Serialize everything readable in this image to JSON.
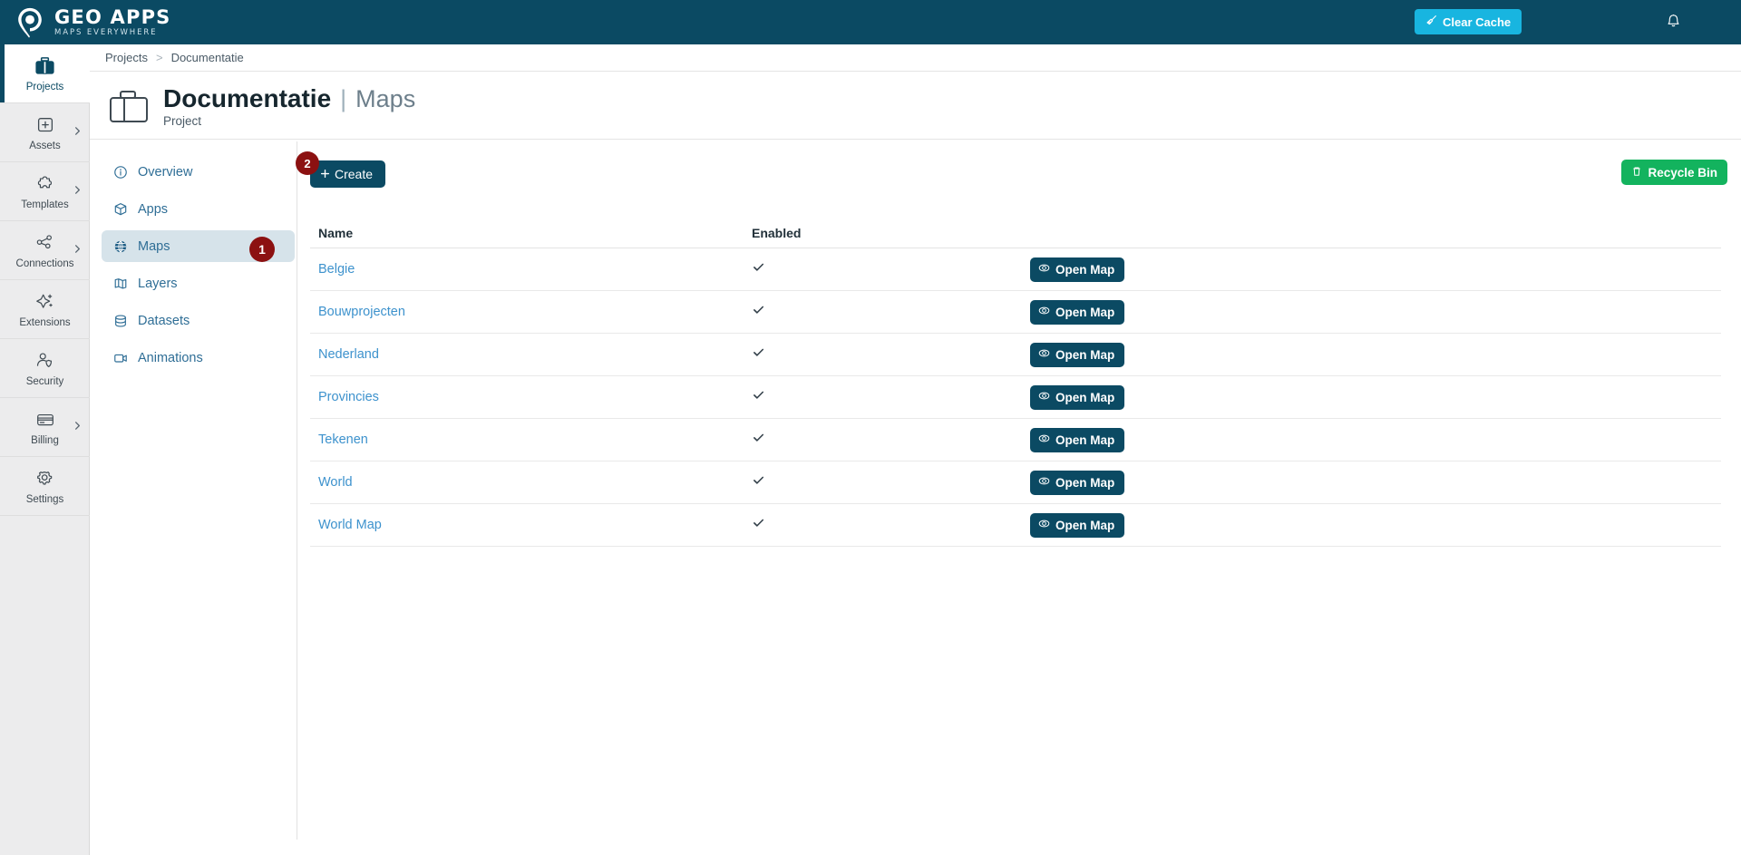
{
  "brand": {
    "name": "GEO APPS",
    "tagline": "MAPS EVERYWHERE",
    "logo_icon": "map-pin-logo-icon"
  },
  "topbar": {
    "clear_cache_label": "Clear Cache",
    "clear_cache_icon": "broom-icon",
    "clear_cache_color": "#18b5e0",
    "notifications_icon": "bell-icon",
    "background_color": "#0b4a63"
  },
  "rail": {
    "items": [
      {
        "label": "Projects",
        "icon": "briefcase-icon",
        "active": true,
        "expandable": false
      },
      {
        "label": "Assets",
        "icon": "plus-square-icon",
        "active": false,
        "expandable": true
      },
      {
        "label": "Templates",
        "icon": "puzzle-icon",
        "active": false,
        "expandable": true
      },
      {
        "label": "Connections",
        "icon": "share-nodes-icon",
        "active": false,
        "expandable": true
      },
      {
        "label": "Extensions",
        "icon": "sparkle-icon",
        "active": false,
        "expandable": false
      },
      {
        "label": "Security",
        "icon": "user-shield-icon",
        "active": false,
        "expandable": false
      },
      {
        "label": "Billing",
        "icon": "credit-card-icon",
        "active": false,
        "expandable": true
      },
      {
        "label": "Settings",
        "icon": "gear-icon",
        "active": false,
        "expandable": false
      }
    ]
  },
  "breadcrumb": {
    "root": "Projects",
    "separator": ">",
    "current": "Documentatie"
  },
  "page_header": {
    "icon": "briefcase-icon",
    "title": "Documentatie",
    "pipe": "|",
    "section": "Maps",
    "subtitle": "Project"
  },
  "project_menu": {
    "items": [
      {
        "label": "Overview",
        "icon": "info-circle-icon",
        "active": false
      },
      {
        "label": "Apps",
        "icon": "cube-icon",
        "active": false
      },
      {
        "label": "Maps",
        "icon": "globe-icon",
        "active": true
      },
      {
        "label": "Layers",
        "icon": "layers-map-icon",
        "active": false
      },
      {
        "label": "Datasets",
        "icon": "database-icon",
        "active": false
      },
      {
        "label": "Animations",
        "icon": "video-icon",
        "active": false
      }
    ]
  },
  "badges": [
    {
      "number": "1",
      "target": "maps-menu-item",
      "color": "#8c1111"
    },
    {
      "number": "2",
      "target": "create-button",
      "color": "#8c1111"
    }
  ],
  "toolbar": {
    "create_label": "Create",
    "create_icon": "plus-icon",
    "create_color": "#0b4a63",
    "recycle_label": "Recycle Bin",
    "recycle_icon": "trash-icon",
    "recycle_color": "#13b35e"
  },
  "table": {
    "columns": [
      "Name",
      "Enabled",
      ""
    ],
    "action_label": "Open Map",
    "action_icon": "eye-icon",
    "check_glyph": "✓",
    "rows": [
      {
        "name": "Belgie",
        "enabled": true
      },
      {
        "name": "Bouwprojecten",
        "enabled": true
      },
      {
        "name": "Nederland",
        "enabled": true
      },
      {
        "name": "Provincies",
        "enabled": true
      },
      {
        "name": "Tekenen",
        "enabled": true
      },
      {
        "name": "World",
        "enabled": true
      },
      {
        "name": "World Map",
        "enabled": true
      }
    ]
  }
}
